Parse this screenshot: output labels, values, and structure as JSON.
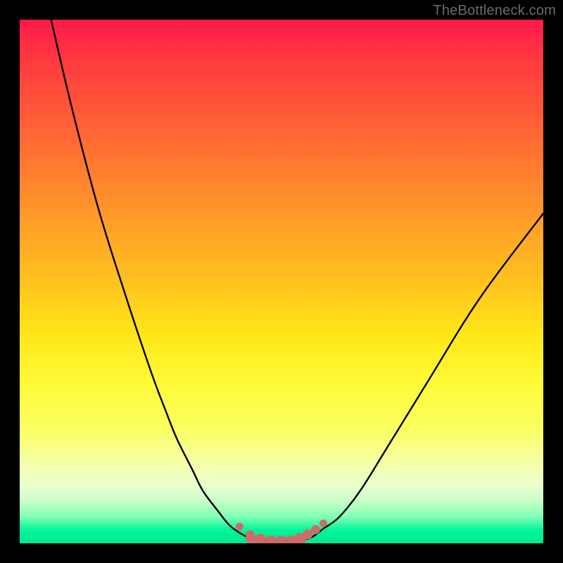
{
  "watermark": "TheBottleneck.com",
  "colors": {
    "frame": "#000000",
    "curve_stroke": "#000000",
    "marker_fill": "#d06a6a",
    "marker_stroke": "#d06a6a",
    "gradient_top": "#ff1a4b",
    "gradient_bottom": "#00e890"
  },
  "chart_data": {
    "type": "line",
    "title": "",
    "xlabel": "",
    "ylabel": "",
    "xlim": [
      0,
      100
    ],
    "ylim": [
      0,
      100
    ],
    "grid": false,
    "legend": false,
    "series": [
      {
        "name": "left-curve",
        "x": [
          6,
          10,
          15,
          20,
          25,
          28,
          30,
          33,
          35,
          38,
          40,
          42,
          44,
          46
        ],
        "y": [
          100,
          83,
          64,
          48,
          33,
          25,
          20,
          14,
          10,
          6,
          3.5,
          2,
          1,
          0.5
        ]
      },
      {
        "name": "right-curve",
        "x": [
          54,
          56,
          58,
          61,
          65,
          70,
          78,
          88,
          100
        ],
        "y": [
          0.5,
          1.3,
          2.8,
          5,
          10,
          18,
          31,
          47,
          63
        ]
      },
      {
        "name": "valley-floor",
        "x": [
          44,
          46,
          48,
          50,
          52,
          54
        ],
        "y": [
          0.9,
          0.5,
          0.3,
          0.3,
          0.5,
          0.9
        ]
      }
    ],
    "markers": {
      "name": "highlight-dots",
      "x": [
        42,
        44,
        46,
        48,
        50,
        52,
        53.5,
        55,
        56.5,
        58
      ],
      "y": [
        3.2,
        1.6,
        0.9,
        0.6,
        0.5,
        0.6,
        1.0,
        1.7,
        2.6,
        3.8
      ],
      "r": [
        5.5,
        6.5,
        7,
        7,
        7,
        7,
        7,
        7,
        6.5,
        5.5
      ]
    }
  }
}
